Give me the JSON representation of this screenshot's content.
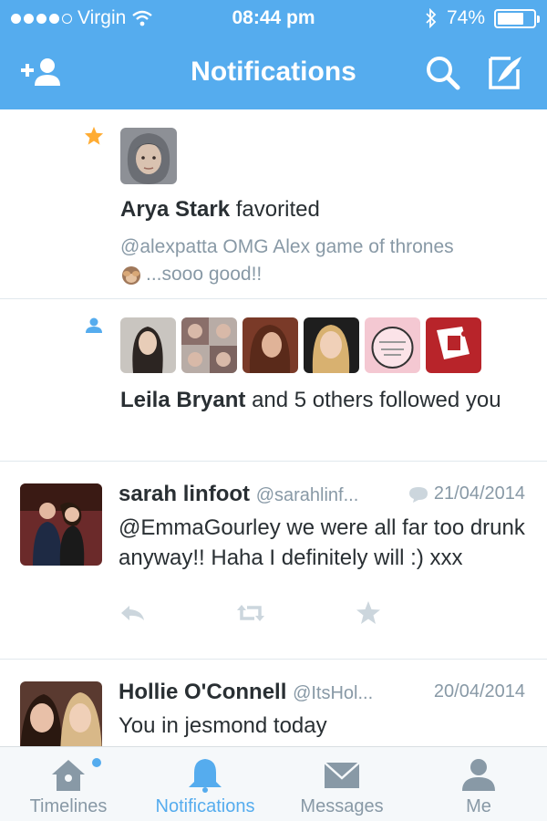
{
  "status_bar": {
    "carrier": "Virgin",
    "time": "08:44 pm",
    "battery_text": "74%",
    "battery_level": 0.74
  },
  "nav": {
    "title": "Notifications",
    "add_user_icon": "add-user-icon",
    "search_icon": "search-icon",
    "compose_icon": "compose-icon"
  },
  "notifications": [
    {
      "type": "favorite",
      "icon": "star-icon",
      "user_name": "Arya Stark",
      "action": "favorited",
      "quote_line1": "@alexpatta OMG Alex game of thrones",
      "quote_line2": "...sooo good!!"
    },
    {
      "type": "follow",
      "icon": "person-icon",
      "user_name": "Leila Bryant",
      "action": "and 5 others followed you",
      "avatar_count": 6
    }
  ],
  "tweets": [
    {
      "name": "sarah linfoot",
      "handle": "@sarahlinf...",
      "date": "21/04/2014",
      "body": "@EmmaGourley we were all far too drunk anyway!! Haha I definitely will :) xxx",
      "reply_icon": "reply-icon",
      "retweet_icon": "retweet-icon",
      "favorite_icon": "star-icon"
    },
    {
      "name": "Hollie O'Connell",
      "handle": "@ItsHol...",
      "date": "20/04/2014",
      "body": "You in jesmond today"
    }
  ],
  "tabs": [
    {
      "label": "Timelines",
      "icon": "home-icon"
    },
    {
      "label": "Notifications",
      "icon": "bell-icon"
    },
    {
      "label": "Messages",
      "icon": "envelope-icon"
    },
    {
      "label": "Me",
      "icon": "person-icon"
    }
  ],
  "colors": {
    "brand": "#55acee",
    "star": "#ffac33",
    "muted": "#8899a6",
    "text": "#292f33"
  }
}
